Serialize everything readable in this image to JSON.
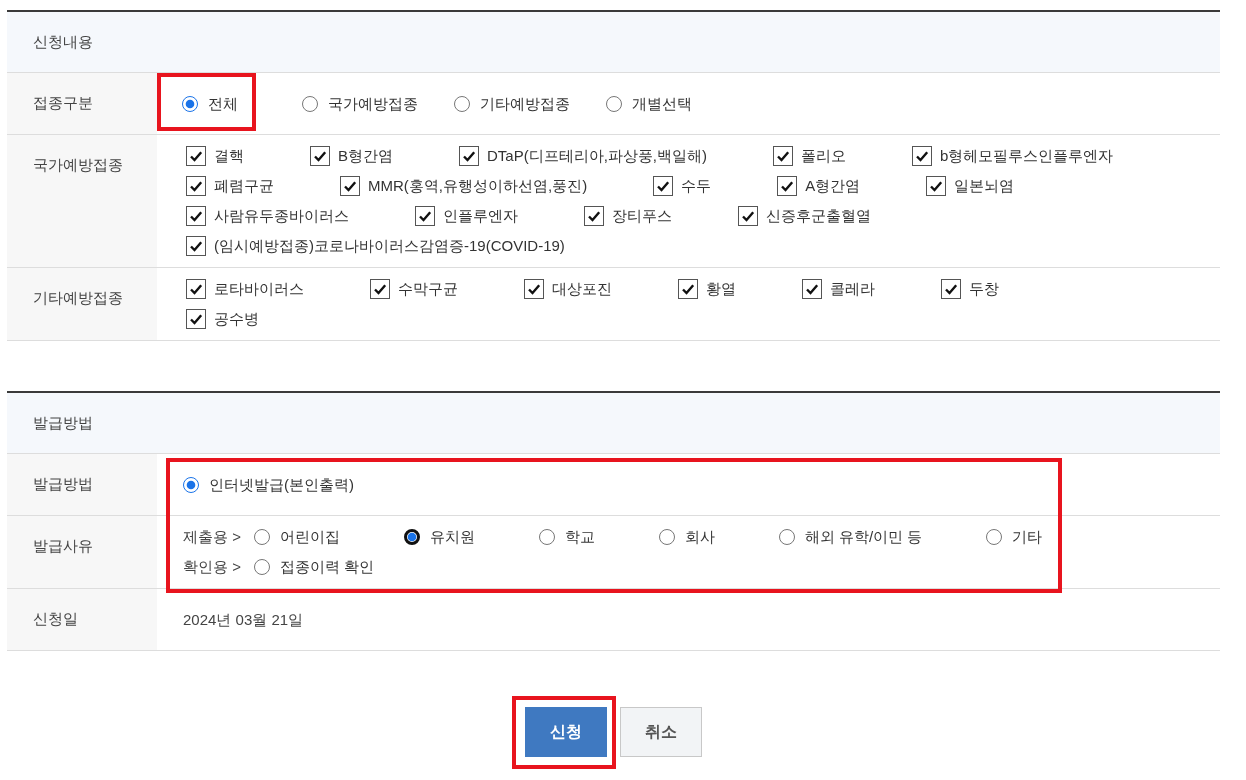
{
  "application_section": {
    "title": "신청내용",
    "vaccination_type": {
      "label": "접종구분",
      "options": [
        {
          "label": "전체",
          "selected": true,
          "highlighted": true
        },
        {
          "label": "국가예방접종",
          "selected": false,
          "highlighted": false
        },
        {
          "label": "기타예방접종",
          "selected": false,
          "highlighted": false
        },
        {
          "label": "개별선택",
          "selected": false,
          "highlighted": false
        }
      ]
    },
    "national_vaccines": {
      "label": "국가예방접종",
      "items": [
        {
          "label": "결핵",
          "checked": true
        },
        {
          "label": "B형간염",
          "checked": true
        },
        {
          "label": "DTaP(디프테리아,파상풍,백일해)",
          "checked": true
        },
        {
          "label": "폴리오",
          "checked": true
        },
        {
          "label": "b형헤모필루스인플루엔자",
          "checked": true
        },
        {
          "label": "폐렴구균",
          "checked": true
        },
        {
          "label": "MMR(홍역,유행성이하선염,풍진)",
          "checked": true
        },
        {
          "label": "수두",
          "checked": true
        },
        {
          "label": "A형간염",
          "checked": true
        },
        {
          "label": "일본뇌염",
          "checked": true
        },
        {
          "label": "사람유두종바이러스",
          "checked": true
        },
        {
          "label": "인플루엔자",
          "checked": true
        },
        {
          "label": "장티푸스",
          "checked": true
        },
        {
          "label": "신증후군출혈열",
          "checked": true
        },
        {
          "label": "(임시예방접종)코로나바이러스감염증-19(COVID-19)",
          "checked": true
        }
      ]
    },
    "other_vaccines": {
      "label": "기타예방접종",
      "items": [
        {
          "label": "로타바이러스",
          "checked": true
        },
        {
          "label": "수막구균",
          "checked": true
        },
        {
          "label": "대상포진",
          "checked": true
        },
        {
          "label": "황열",
          "checked": true
        },
        {
          "label": "콜레라",
          "checked": true
        },
        {
          "label": "두창",
          "checked": true
        },
        {
          "label": "공수병",
          "checked": true
        }
      ]
    }
  },
  "issuance_section": {
    "title": "발급방법",
    "highlighted": true,
    "method": {
      "label": "발급방법",
      "options": [
        {
          "label": "인터넷발급(본인출력)",
          "selected": true
        }
      ]
    },
    "reason": {
      "label": "발급사유",
      "groups": [
        {
          "label": "제출용 >",
          "options": [
            {
              "label": "어린이집",
              "selected": false,
              "focused": false
            },
            {
              "label": "유치원",
              "selected": true,
              "focused": true
            },
            {
              "label": "학교",
              "selected": false,
              "focused": false
            },
            {
              "label": "회사",
              "selected": false,
              "focused": false
            },
            {
              "label": "해외 유학/이민 등",
              "selected": false,
              "focused": false
            },
            {
              "label": "기타",
              "selected": false,
              "focused": false
            }
          ]
        },
        {
          "label": "확인용 >",
          "options": [
            {
              "label": "접종이력 확인",
              "selected": false,
              "focused": false
            }
          ]
        }
      ]
    },
    "date": {
      "label": "신청일",
      "value": "2024년 03월 21일"
    }
  },
  "buttons": [
    {
      "label": "신청",
      "kind": "primary",
      "highlighted": true
    },
    {
      "label": "취소",
      "kind": "secondary",
      "highlighted": false
    }
  ]
}
